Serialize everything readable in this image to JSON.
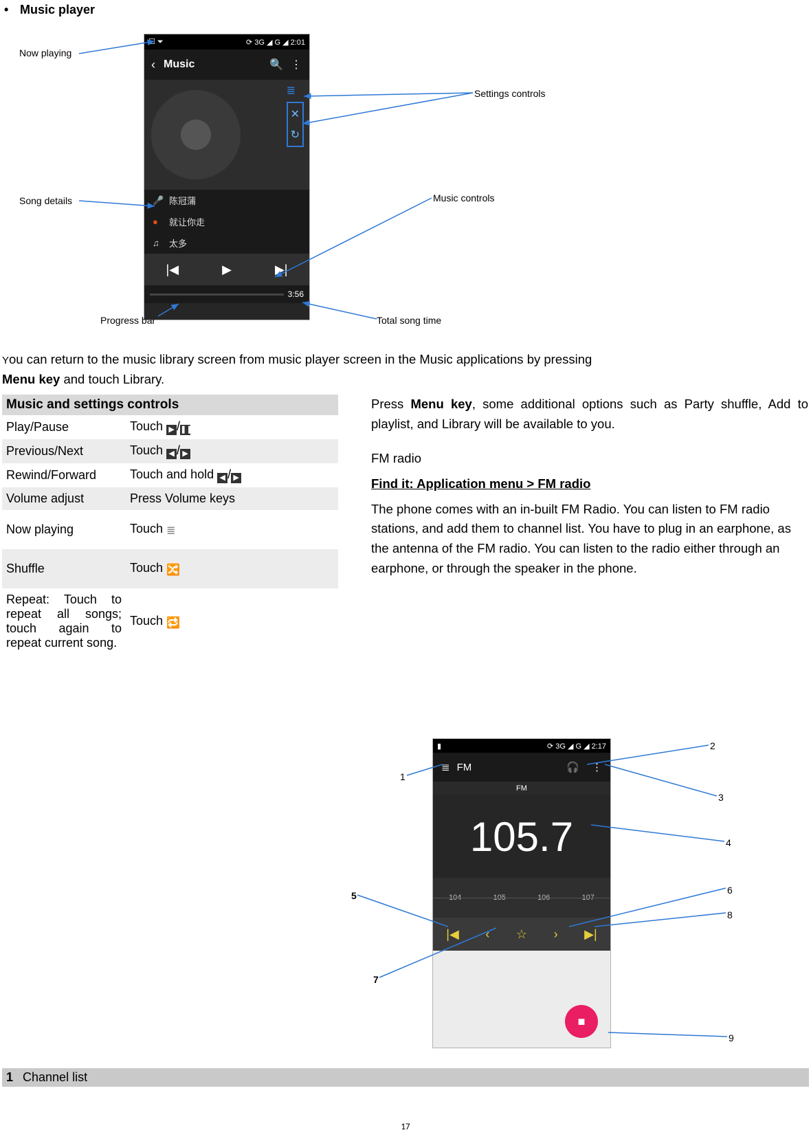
{
  "heading": "Music player",
  "callouts_music": {
    "now_playing": "Now playing",
    "song_details": "Song details",
    "progress_bar": "Progress bar",
    "settings_controls": "Settings controls",
    "music_controls": "Music controls",
    "total_song_time": "Total song time"
  },
  "music_screen": {
    "status_left": "☐  ⏷",
    "status_right": "⟳ 3G ◢ G ◢  2:01",
    "app_title": "Music",
    "song1": "陈冠蒲",
    "song2": "就让你走",
    "song3": "太多",
    "total_time": "3:56"
  },
  "para1_pre": "ou can return to the music library screen from music player screen in the Music applications by pressing ",
  "para1_menu": "Menu key",
  "para1_post": " and touch Library.",
  "small_caps_Y": "Y",
  "table_head": "Music and settings controls",
  "rows": [
    {
      "l": "Play/Pause",
      "r_pre": "Touch ",
      "i": "play-pause"
    },
    {
      "l": "Previous/Next",
      "r_pre": "Touch ",
      "i": "prev-next"
    },
    {
      "l": "Rewind/Forward",
      "r_pre": "Touch and hold ",
      "i": "prev-next"
    },
    {
      "l": "Volume adjust",
      "r_pre": "Press Volume keys",
      "i": ""
    },
    {
      "l": "Now playing",
      "r_pre": "Touch ",
      "i": "queue"
    },
    {
      "l": "Shuffle",
      "r_pre": "Touch ",
      "i": "shuffle"
    },
    {
      "l": "Repeat: Touch to repeat all songs; touch again to repeat current song.",
      "r_pre": "Touch ",
      "i": "repeat"
    }
  ],
  "right_col": {
    "p1_pre": "Press ",
    "p1_menu": "Menu key",
    "p1_post": ", some additional options such as Party shuffle, Add to playlist, and Library will be available to you.",
    "fm_title": "FM radio",
    "finder": "Find it: Application menu > FM radio",
    "fm_body": "The phone comes with an in-built FM Radio. You can listen to FM radio stations, and add them to channel list. You have to plug in an earphone, as the antenna of the FM radio. You can listen to the radio either through an earphone, or through the speaker in the phone."
  },
  "fm_screen": {
    "status_right": "⟳ 3G ◢ G ◢  2:17",
    "top_left_label": "FM",
    "fm_head": "FM",
    "freq": "105.7",
    "dial_ticks": [
      "104",
      "105",
      "106",
      "107"
    ]
  },
  "fm_nums": {
    "n1": "1",
    "n2": "2",
    "n3": "3",
    "n4": "4",
    "n5": "5",
    "n6": "6",
    "n7": "7",
    "n8": "8",
    "n9": "9"
  },
  "channel_bar": {
    "num": "1",
    "label": "Channel list"
  },
  "page_number": "17"
}
